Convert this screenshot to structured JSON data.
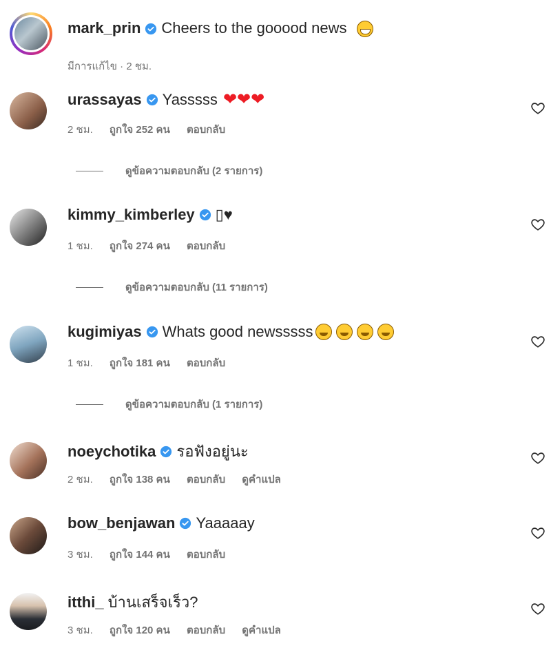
{
  "caption": {
    "username": "mark_prin",
    "text": "Cheers to the gooood news",
    "emoji": "😁",
    "meta": "มีการแก้ไข · 2 ชม."
  },
  "comments": [
    {
      "username": "urassayas",
      "text": "Yasssss",
      "emoji": "❤❤❤",
      "time": "2 ชม.",
      "likes": "ถูกใจ 252 คน",
      "reply": "ตอบกลับ",
      "translate": "",
      "replies": "ดูข้อความตอบกลับ (2 รายการ)"
    },
    {
      "username": "kimmy_kimberley",
      "text": "▯♥",
      "emoji": "",
      "time": "1 ชม.",
      "likes": "ถูกใจ 274 คน",
      "reply": "ตอบกลับ",
      "translate": "",
      "replies": "ดูข้อความตอบกลับ (11 รายการ)"
    },
    {
      "username": "kugimiyas",
      "text": "Whats good newsssss",
      "emoji": "🥰🥰🥰🥰",
      "time": "1 ชม.",
      "likes": "ถูกใจ 181 คน",
      "reply": "ตอบกลับ",
      "translate": "",
      "replies": "ดูข้อความตอบกลับ (1 รายการ)"
    },
    {
      "username": "noeychotika",
      "text": "รอฟังอยู่นะ",
      "emoji": "",
      "time": "2 ชม.",
      "likes": "ถูกใจ 138 คน",
      "reply": "ตอบกลับ",
      "translate": "ดูคำแปล",
      "replies": ""
    },
    {
      "username": "bow_benjawan",
      "text": "Yaaaaay",
      "emoji": "",
      "time": "3 ชม.",
      "likes": "ถูกใจ 144 คน",
      "reply": "ตอบกลับ",
      "translate": "",
      "replies": ""
    },
    {
      "username": "itthi_",
      "text": "บ้านเสร็จเร็ว?",
      "emoji": "",
      "time": "3 ชม.",
      "likes": "ถูกใจ 120 คน",
      "reply": "ตอบกลับ",
      "translate": "ดูคำแปล",
      "replies": ""
    }
  ],
  "colors": {
    "verified": "#3897f0",
    "meta_text": "#737373",
    "heart_emoji": "#ed1c24"
  }
}
